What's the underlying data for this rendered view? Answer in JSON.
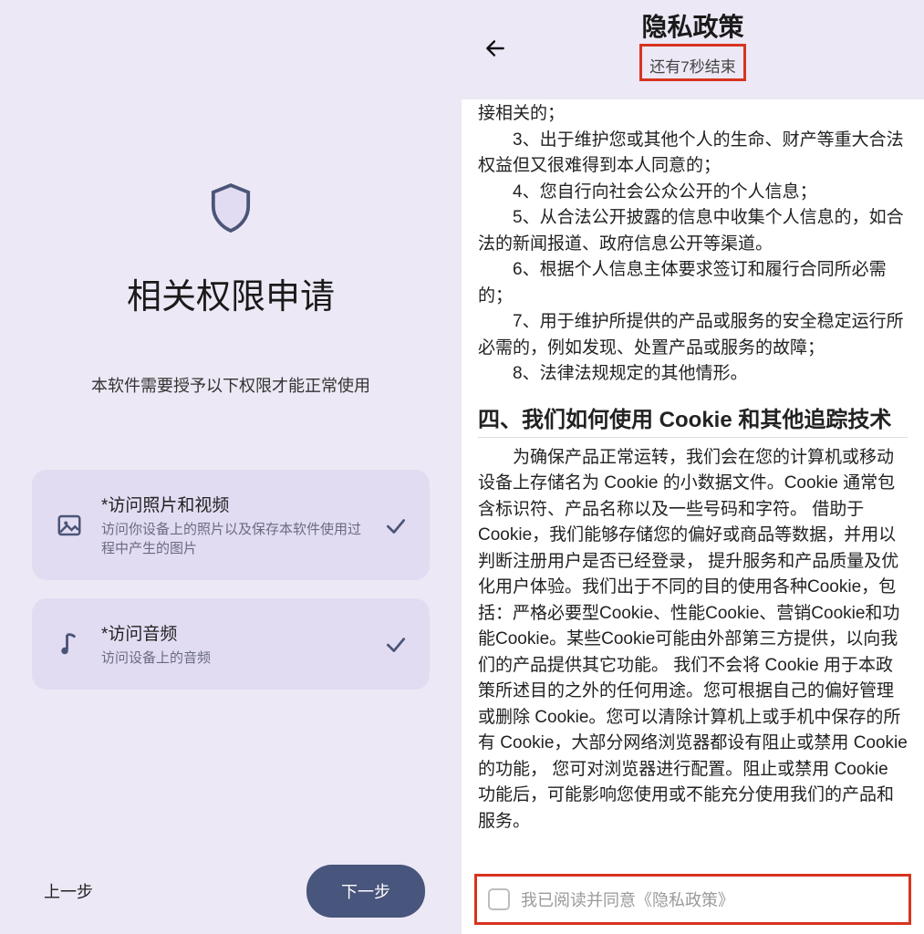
{
  "left": {
    "title": "相关权限申请",
    "subtitle": "本软件需要授予以下权限才能正常使用",
    "perms": [
      {
        "title": "*访问照片和视频",
        "desc": "访问你设备上的照片以及保存本软件使用过程中产生的图片"
      },
      {
        "title": "*访问音频",
        "desc": "访问设备上的音频"
      }
    ],
    "prev": "上一步",
    "next": "下一步"
  },
  "right": {
    "header_title": "隐私政策",
    "header_sub": "还有7秒结束",
    "truncated_top": "接相关的；",
    "clauses": [
      "3、出于维护您或其他个人的生命、财产等重大合法权益但又很难得到本人同意的；",
      "4、您自行向社会公众公开的个人信息；",
      "5、从合法公开披露的信息中收集个人信息的，如合法的新闻报道、政府信息公开等渠道。",
      "6、根据个人信息主体要求签订和履行合同所必需的；",
      "7、用于维护所提供的产品或服务的安全稳定运行所必需的，例如发现、处置产品或服务的故障；",
      "8、法律法规规定的其他情形。"
    ],
    "section4_title": "四、我们如何使用 Cookie 和其他追踪技术",
    "cookie_body": "为确保产品正常运转，我们会在您的计算机或移动设备上存储名为 Cookie 的小数据文件。Cookie 通常包含标识符、产品名称以及一些号码和字符。 借助于 Cookie，我们能够存储您的偏好或商品等数据，并用以判断注册用户是否已经登录， 提升服务和产品质量及优化用户体验。我们出于不同的目的使用各种Cookie，包括：严格必要型Cookie、性能Cookie、营销Cookie和功能Cookie。某些Cookie可能由外部第三方提供，以向我们的产品提供其它功能。 我们不会将 Cookie 用于本政策所述目的之外的任何用途。您可根据自己的偏好管理或删除 Cookie。您可以清除计算机上或手机中保存的所有 Cookie，大部分网络浏览器都设有阻止或禁用 Cookie 的功能， 您可对浏览器进行配置。阻止或禁用 Cookie 功能后，可能影响您使用或不能充分使用我们的产品和服务。",
    "agree_text": "我已阅读并同意《隐私政策》"
  }
}
